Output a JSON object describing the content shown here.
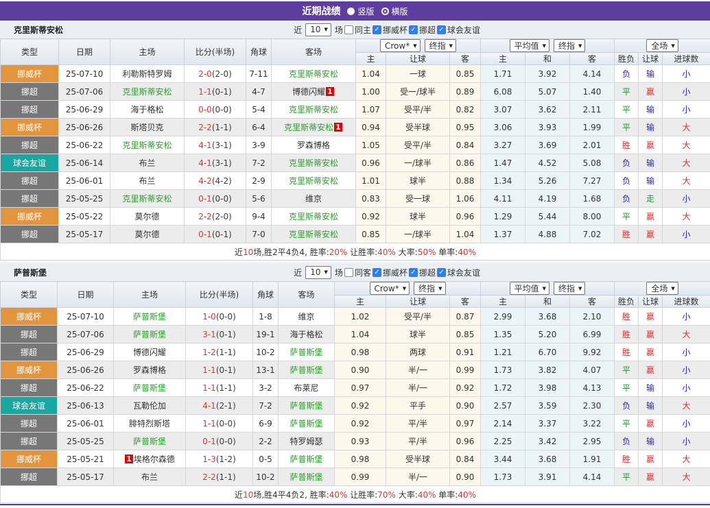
{
  "title_bar": {
    "title": "近期战绩",
    "radio_vertical": "竖版",
    "radio_horizontal": "横版"
  },
  "controls": {
    "near_label": "近",
    "matches_value": "10",
    "games_label": "场",
    "league_filters": [
      "挪威杯",
      "挪超",
      "球会友谊"
    ]
  },
  "columns": {
    "left": [
      "类型",
      "日期",
      "主场",
      "比分(半场)",
      "角球",
      "客场"
    ],
    "sub": [
      "主",
      "让球",
      "客",
      "主",
      "和",
      "客",
      "胜负",
      "让球",
      "进球数"
    ]
  },
  "dropdowns": {
    "crow": "Crow*",
    "final1": "终指",
    "avg": "平均值",
    "final2": "终指",
    "full": "全场"
  },
  "league_colors": {
    "挪威杯": "#e2953c",
    "挪超": "#777777",
    "球会友谊": "#18a8a1"
  },
  "result_colors": {
    "胜": "red",
    "平": "green",
    "负": "blue",
    "赢": "red",
    "输": "blue",
    "走": "green",
    "大": "red",
    "小": "blue"
  },
  "accent_colors": {
    "titlebar": "#5d3e9e",
    "team_green": "#2aa12a",
    "score_red": "#e03131",
    "bottom_line": "#4040b4"
  },
  "sections": [
    {
      "team": "克里斯蒂安松",
      "same_label": "同主",
      "rows": [
        {
          "league": "挪威杯",
          "date": "25-07-10",
          "home": "利勒斯特罗姆",
          "home_green": false,
          "home_badge": "",
          "score": "2-0",
          "half": "(2-0)",
          "corner": "7-11",
          "away": "克里斯蒂安松",
          "away_green": true,
          "away_badge": "",
          "odds": [
            "1.04",
            "一球",
            "0.85"
          ],
          "avg": [
            "1.71",
            "3.92",
            "4.14"
          ],
          "res": [
            "负",
            "输",
            "小"
          ]
        },
        {
          "league": "挪超",
          "date": "25-07-06",
          "home": "克里斯蒂安松",
          "home_green": true,
          "home_badge": "",
          "score": "1-1",
          "half": "(0-1)",
          "corner": "4-7",
          "away": "博德闪耀",
          "away_green": false,
          "away_badge": "post",
          "odds": [
            "1.00",
            "受一/球半",
            "0.89"
          ],
          "avg": [
            "6.08",
            "5.07",
            "1.40"
          ],
          "res": [
            "平",
            "赢",
            "小"
          ]
        },
        {
          "league": "挪超",
          "date": "25-06-29",
          "home": "海于格松",
          "home_green": false,
          "home_badge": "",
          "score": "0-0",
          "half": "(0-0)",
          "corner": "5-4",
          "away": "克里斯蒂安松",
          "away_green": true,
          "away_badge": "",
          "odds": [
            "1.07",
            "受平/半",
            "0.82"
          ],
          "avg": [
            "3.07",
            "3.62",
            "2.11"
          ],
          "res": [
            "平",
            "输",
            "小"
          ]
        },
        {
          "league": "挪威杯",
          "date": "25-06-26",
          "home": "斯塔贝克",
          "home_green": false,
          "home_badge": "",
          "score": "2-2",
          "half": "(1-1)",
          "corner": "6-4",
          "away": "克里斯蒂安松",
          "away_green": true,
          "away_badge": "post",
          "odds": [
            "0.94",
            "受半球",
            "0.95"
          ],
          "avg": [
            "3.06",
            "3.93",
            "1.99"
          ],
          "res": [
            "平",
            "输",
            "大"
          ]
        },
        {
          "league": "挪超",
          "date": "25-06-22",
          "home": "克里斯蒂安松",
          "home_green": true,
          "home_badge": "",
          "score": "4-1",
          "half": "(3-1)",
          "corner": "3-9",
          "away": "罗森博格",
          "away_green": false,
          "away_badge": "",
          "odds": [
            "1.05",
            "受平/半",
            "0.84"
          ],
          "avg": [
            "3.27",
            "3.69",
            "2.01"
          ],
          "res": [
            "胜",
            "赢",
            "大"
          ]
        },
        {
          "league": "球会友谊",
          "date": "25-06-14",
          "home": "布兰",
          "home_green": false,
          "home_badge": "",
          "score": "4-1",
          "half": "(3-1)",
          "corner": "7-2",
          "away": "克里斯蒂安松",
          "away_green": true,
          "away_badge": "",
          "odds": [
            "0.96",
            "一/球半",
            "0.86"
          ],
          "avg": [
            "1.47",
            "4.52",
            "5.08"
          ],
          "res": [
            "负",
            "输",
            "大"
          ]
        },
        {
          "league": "挪超",
          "date": "25-06-01",
          "home": "布兰",
          "home_green": false,
          "home_badge": "",
          "score": "4-2",
          "half": "(4-2)",
          "corner": "2-9",
          "away": "克里斯蒂安松",
          "away_green": true,
          "away_badge": "",
          "odds": [
            "1.01",
            "球半",
            "0.88"
          ],
          "avg": [
            "1.34",
            "5.26",
            "7.27"
          ],
          "res": [
            "负",
            "输",
            "大"
          ]
        },
        {
          "league": "挪超",
          "date": "25-05-25",
          "home": "克里斯蒂安松",
          "home_green": true,
          "home_badge": "",
          "score": "0-1",
          "half": "(0-0)",
          "corner": "5-6",
          "away": "维京",
          "away_green": false,
          "away_badge": "",
          "odds": [
            "0.83",
            "受一球",
            "1.06"
          ],
          "avg": [
            "4.11",
            "4.19",
            "1.68"
          ],
          "res": [
            "负",
            "走",
            "小"
          ]
        },
        {
          "league": "挪威杯",
          "date": "25-05-22",
          "home": "莫尔德",
          "home_green": false,
          "home_badge": "",
          "score": "2-2",
          "half": "(2-0)",
          "corner": "9-4",
          "away": "克里斯蒂安松",
          "away_green": true,
          "away_badge": "",
          "odds": [
            "0.92",
            "球半",
            "0.96"
          ],
          "avg": [
            "1.29",
            "5.44",
            "8.00"
          ],
          "res": [
            "平",
            "赢",
            "大"
          ]
        },
        {
          "league": "挪超",
          "date": "25-05-17",
          "home": "莫尔德",
          "home_green": false,
          "home_badge": "",
          "score": "0-1",
          "half": "(0-1)",
          "corner": "7-0",
          "away": "克里斯蒂安松",
          "away_green": true,
          "away_badge": "",
          "odds": [
            "0.85",
            "一/球半",
            "1.04"
          ],
          "avg": [
            "1.37",
            "4.88",
            "7.02"
          ],
          "res": [
            "胜",
            "赢",
            "小"
          ]
        }
      ],
      "summary": [
        {
          "t": "近"
        },
        {
          "t": "10",
          "red": true
        },
        {
          "t": "场,胜2平4负4, 胜率:"
        },
        {
          "t": "20%",
          "red": true
        },
        {
          "t": " 让胜率:"
        },
        {
          "t": "40%",
          "red": true
        },
        {
          "t": " 大率:"
        },
        {
          "t": "50%",
          "red": true
        },
        {
          "t": " 单率:"
        },
        {
          "t": "40%",
          "red": true
        }
      ]
    },
    {
      "team": "萨普斯堡",
      "same_label": "同客",
      "rows": [
        {
          "league": "挪威杯",
          "date": "25-07-10",
          "home": "萨普斯堡",
          "home_green": true,
          "home_badge": "",
          "score": "1-0",
          "half": "(0-0)",
          "corner": "1-8",
          "away": "维京",
          "away_green": false,
          "away_badge": "",
          "odds": [
            "1.02",
            "受平/半",
            "0.87"
          ],
          "avg": [
            "2.99",
            "3.68",
            "2.10"
          ],
          "res": [
            "胜",
            "赢",
            "小"
          ]
        },
        {
          "league": "挪超",
          "date": "25-07-06",
          "home": "萨普斯堡",
          "home_green": true,
          "home_badge": "",
          "score": "3-1",
          "half": "(0-1)",
          "corner": "19-1",
          "away": "海于格松",
          "away_green": false,
          "away_badge": "",
          "odds": [
            "1.04",
            "球半",
            "0.85"
          ],
          "avg": [
            "1.35",
            "5.20",
            "6.99"
          ],
          "res": [
            "胜",
            "赢",
            "大"
          ]
        },
        {
          "league": "挪超",
          "date": "25-06-29",
          "home": "博德闪耀",
          "home_green": false,
          "home_badge": "",
          "score": "1-2",
          "half": "(1-1)",
          "corner": "10-2",
          "away": "萨普斯堡",
          "away_green": true,
          "away_badge": "",
          "odds": [
            "0.98",
            "两球",
            "0.91"
          ],
          "avg": [
            "1.21",
            "6.70",
            "9.92"
          ],
          "res": [
            "胜",
            "赢",
            "小"
          ]
        },
        {
          "league": "挪威杯",
          "date": "25-06-26",
          "home": "罗森博格",
          "home_green": false,
          "home_badge": "",
          "score": "1-1",
          "half": "(0-1)",
          "corner": "13-1",
          "away": "萨普斯堡",
          "away_green": true,
          "away_badge": "",
          "odds": [
            "0.90",
            "半/一",
            "0.99"
          ],
          "avg": [
            "1.73",
            "3.82",
            "4.07"
          ],
          "res": [
            "平",
            "赢",
            "小"
          ]
        },
        {
          "league": "挪超",
          "date": "25-06-22",
          "home": "萨普斯堡",
          "home_green": true,
          "home_badge": "",
          "score": "1-1",
          "half": "(1-1)",
          "corner": "3-2",
          "away": "布莱尼",
          "away_green": false,
          "away_badge": "",
          "odds": [
            "0.97",
            "半/一",
            "0.92"
          ],
          "avg": [
            "1.72",
            "3.98",
            "4.13"
          ],
          "res": [
            "平",
            "输",
            "小"
          ]
        },
        {
          "league": "球会友谊",
          "date": "25-06-13",
          "home": "瓦勒伦加",
          "home_green": false,
          "home_badge": "",
          "score": "4-1",
          "half": "(2-1)",
          "corner": "7-2",
          "away": "萨普斯堡",
          "away_green": true,
          "away_badge": "",
          "odds": [
            "0.92",
            "平手",
            "0.90"
          ],
          "avg": [
            "2.57",
            "3.59",
            "2.30"
          ],
          "res": [
            "负",
            "输",
            "大"
          ]
        },
        {
          "league": "挪超",
          "date": "25-06-01",
          "home": "腓特烈斯塔",
          "home_green": false,
          "home_badge": "",
          "score": "1-1",
          "half": "(0-0)",
          "corner": "6-9",
          "away": "萨普斯堡",
          "away_green": true,
          "away_badge": "",
          "odds": [
            "0.92",
            "平/半",
            "0.97"
          ],
          "avg": [
            "2.14",
            "3.37",
            "3.22"
          ],
          "res": [
            "平",
            "赢",
            "小"
          ]
        },
        {
          "league": "挪超",
          "date": "25-05-25",
          "home": "萨普斯堡",
          "home_green": true,
          "home_badge": "",
          "score": "0-1",
          "half": "(0-0)",
          "corner": "2-2",
          "away": "特罗姆瑟",
          "away_green": false,
          "away_badge": "",
          "odds": [
            "0.93",
            "平/半",
            "0.96"
          ],
          "avg": [
            "2.25",
            "3.42",
            "2.95"
          ],
          "res": [
            "负",
            "输",
            "小"
          ]
        },
        {
          "league": "挪威杯",
          "date": "25-05-21",
          "home": "埃格尔森德",
          "home_green": false,
          "home_badge": "pre",
          "score": "1-3",
          "half": "(1-2)",
          "corner": "0-5",
          "away": "萨普斯堡",
          "away_green": true,
          "away_badge": "",
          "odds": [
            "0.98",
            "受半球",
            "0.84"
          ],
          "avg": [
            "3.44",
            "3.68",
            "1.91"
          ],
          "res": [
            "胜",
            "赢",
            "大"
          ]
        },
        {
          "league": "挪超",
          "date": "25-05-17",
          "home": "布兰",
          "home_green": false,
          "home_badge": "",
          "score": "2-2",
          "half": "(1-1)",
          "corner": "10-2",
          "away": "萨普斯堡",
          "away_green": true,
          "away_badge": "",
          "odds": [
            "0.99",
            "半/一",
            "0.90"
          ],
          "avg": [
            "1.73",
            "3.91",
            "4.14"
          ],
          "res": [
            "平",
            "赢",
            "大"
          ]
        }
      ],
      "summary": [
        {
          "t": "近"
        },
        {
          "t": "10",
          "red": true
        },
        {
          "t": "场,胜4平4负2, 胜率:"
        },
        {
          "t": "40%",
          "red": true
        },
        {
          "t": " 让胜率:"
        },
        {
          "t": "70%",
          "red": true
        },
        {
          "t": " 大率:"
        },
        {
          "t": "40%",
          "red": true
        },
        {
          "t": " 单率:"
        },
        {
          "t": "40%",
          "red": true
        }
      ]
    }
  ],
  "badge_label": "1"
}
